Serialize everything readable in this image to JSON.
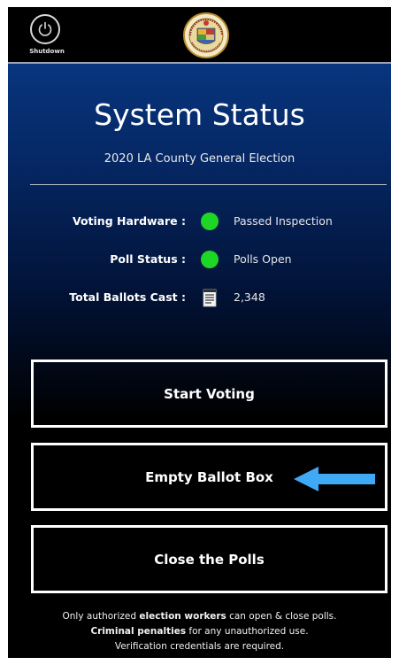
{
  "header": {
    "shutdown_label": "Shutdown",
    "seal_icon": "la-county-seal-icon"
  },
  "main": {
    "title": "System Status",
    "subtitle": "2020 LA County General Election",
    "status": [
      {
        "label": "Voting Hardware :",
        "indicator": "green-status-dot",
        "value": "Passed Inspection"
      },
      {
        "label": "Poll Status :",
        "indicator": "green-status-dot",
        "value": "Polls Open"
      },
      {
        "label": "Total Ballots Cast :",
        "indicator": "ballot-document-icon",
        "value": "2,348"
      }
    ],
    "buttons": {
      "start_voting": "Start Voting",
      "empty_ballot_box": "Empty Ballot Box",
      "close_polls": "Close the Polls"
    },
    "arrow_icon": "left-arrow-icon"
  },
  "footer": {
    "line1_pre": "Only authorized ",
    "line1_bold": "election workers",
    "line1_post": " can open & close polls.",
    "line2_bold": "Criminal penalties",
    "line2_post": " for any unauthorized use.",
    "line3": "Verification credentials are required."
  },
  "colors": {
    "status_green": "#1ed626",
    "arrow_blue": "#3fa9f5",
    "gradient_top": "#08357e",
    "background": "#000000"
  }
}
